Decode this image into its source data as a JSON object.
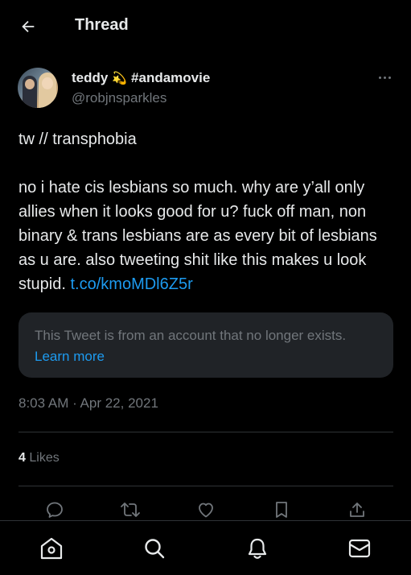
{
  "header": {
    "title": "Thread",
    "back_icon": "arrow-left-icon"
  },
  "author": {
    "name": "teddy",
    "emoji": "💫",
    "hashtag": "#andamovie",
    "handle": "@robjnsparkles"
  },
  "tweet": {
    "line1": "tw // transphobia",
    "body": "no i hate cis lesbians so much. why are y’all only allies when it looks good for u? fuck off man, non binary & trans lesbians are as every bit of lesbians as u are. also tweeting shit like this makes u look stupid.",
    "link": "t.co/kmoMDl6Z5r"
  },
  "quote": {
    "text": "This Tweet is from an account that no longer exists.",
    "link": "Learn more"
  },
  "timestamp": "8:03 AM · Apr 22, 2021",
  "likes": {
    "count": "4",
    "label": "Likes"
  },
  "actions": [
    "reply-icon",
    "retweet-icon",
    "like-icon",
    "bookmark-icon",
    "share-icon"
  ],
  "bottom_nav": [
    "home-icon",
    "search-icon",
    "notifications-icon",
    "messages-icon"
  ],
  "colors": {
    "background": "#000000",
    "text": "#e7e9ea",
    "secondary": "#71767b",
    "accent": "#1d9bf0",
    "quote_bg": "#202327",
    "divider": "#2f3336"
  }
}
